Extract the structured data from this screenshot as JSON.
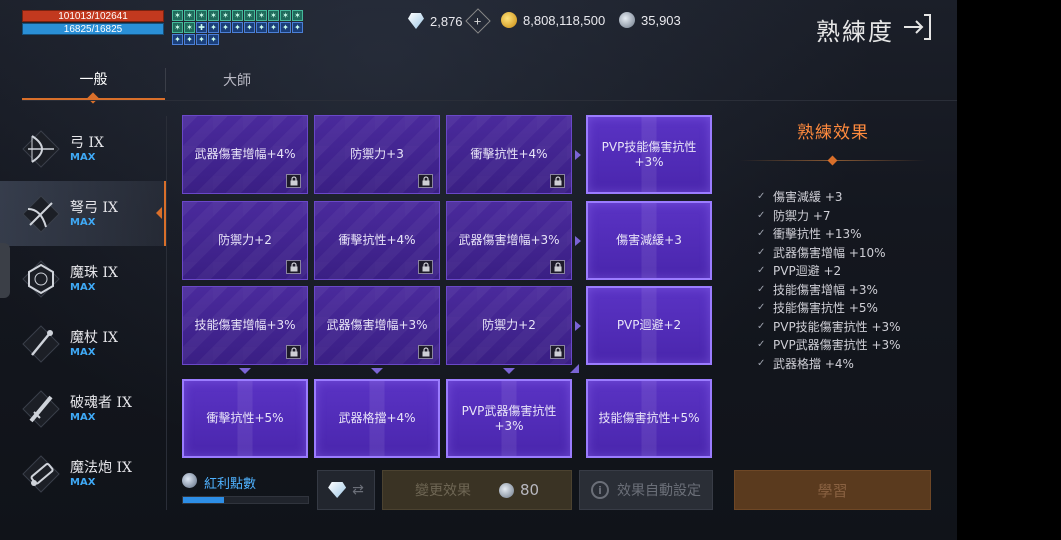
{
  "status": {
    "hp": "101013/102641",
    "mp": "16825/16825",
    "buffs": [
      "✶",
      "✶",
      "✶",
      "✶",
      "✶",
      "✶",
      "✶",
      "✶",
      "✶",
      "✶",
      "✶",
      "✶",
      "✶",
      "✚",
      "✦",
      "✦",
      "✦",
      "✦",
      "✦",
      "✦",
      "✦",
      "✦",
      "✦",
      "✦",
      "✦",
      "✦"
    ]
  },
  "currency": {
    "diamonds": "2,876",
    "gold": "8,808,118,500",
    "silver": "35,903"
  },
  "header": {
    "title": "熟練度"
  },
  "tabs": [
    {
      "label": "一般",
      "active": true
    },
    {
      "label": "大師",
      "active": false
    }
  ],
  "weapons": [
    {
      "name": "弓 IX",
      "level": "MAX",
      "icon": "bow-icon"
    },
    {
      "name": "弩弓 IX",
      "level": "MAX",
      "icon": "crossbow-icon"
    },
    {
      "name": "魔珠 IX",
      "level": "MAX",
      "icon": "orb-icon"
    },
    {
      "name": "魔杖 IX",
      "level": "MAX",
      "icon": "wand-icon"
    },
    {
      "name": "破魂者 IX",
      "level": "MAX",
      "icon": "soulbreaker-icon"
    },
    {
      "name": "魔法炮 IX",
      "level": "MAX",
      "icon": "cannon-icon"
    }
  ],
  "grid": [
    [
      {
        "label": "武器傷害增幅+4%",
        "locked": true,
        "active": false
      },
      {
        "label": "防禦力+3",
        "locked": true,
        "active": false
      },
      {
        "label": "衝擊抗性+4%",
        "locked": true,
        "active": false
      },
      {
        "label": "PVP技能傷害抗性 +3%",
        "locked": false,
        "active": true
      }
    ],
    [
      {
        "label": "防禦力+2",
        "locked": true,
        "active": false
      },
      {
        "label": "衝擊抗性+4%",
        "locked": true,
        "active": false
      },
      {
        "label": "武器傷害增幅+3%",
        "locked": true,
        "active": false
      },
      {
        "label": "傷害減緩+3",
        "locked": false,
        "active": true
      }
    ],
    [
      {
        "label": "技能傷害增幅+3%",
        "locked": true,
        "active": false
      },
      {
        "label": "武器傷害增幅+3%",
        "locked": true,
        "active": false
      },
      {
        "label": "防禦力+2",
        "locked": true,
        "active": false
      },
      {
        "label": "PVP迴避+2",
        "locked": false,
        "active": true
      }
    ],
    [
      {
        "label": "衝擊抗性+5%",
        "locked": false,
        "active": true
      },
      {
        "label": "武器格擋+4%",
        "locked": false,
        "active": true
      },
      {
        "label": "PVP武器傷害抗性 +3%",
        "locked": false,
        "active": true
      },
      {
        "label": "技能傷害抗性+5%",
        "locked": false,
        "active": true
      }
    ]
  ],
  "effects": {
    "title": "熟練效果",
    "items": [
      "傷害減緩 +3",
      "防禦力 +7",
      "衝擊抗性 +13%",
      "武器傷害增幅 +10%",
      "PVP迴避 +2",
      "技能傷害增幅 +3%",
      "技能傷害抗性 +5%",
      "PVP技能傷害抗性 +3%",
      "PVP武器傷害抗性 +3%",
      "武器格擋 +4%"
    ]
  },
  "bonus": {
    "label": "紅利點數",
    "progress": 0.33
  },
  "actions": {
    "change_label": "變更效果",
    "change_cost": "80",
    "auto_label": "效果自動設定",
    "learn_label": "學習"
  },
  "colors": {
    "accent": "#d96f2a",
    "effect_title": "#ff8a3d",
    "max_badge": "#3fa9f5",
    "cell_purple": "#4a26ad"
  }
}
